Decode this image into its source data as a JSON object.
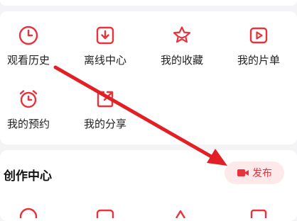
{
  "colors": {
    "accent": "#e8323c",
    "publish_bg": "#fde9ea",
    "page_bg": "#f4f4f6"
  },
  "menu": {
    "items": [
      {
        "label": "观看历史",
        "icon": "clock-icon"
      },
      {
        "label": "离线中心",
        "icon": "download-icon"
      },
      {
        "label": "我的收藏",
        "icon": "star-icon"
      },
      {
        "label": "我的片单",
        "icon": "play-list-icon"
      },
      {
        "label": "我的预约",
        "icon": "alarm-clock-icon"
      },
      {
        "label": "我的分享",
        "icon": "share-icon"
      }
    ]
  },
  "creation": {
    "title": "创作中心",
    "publish_label": "发布",
    "publish_icon": "video-camera-icon"
  },
  "annotation": {
    "icon": "red-arrow-annotation"
  }
}
